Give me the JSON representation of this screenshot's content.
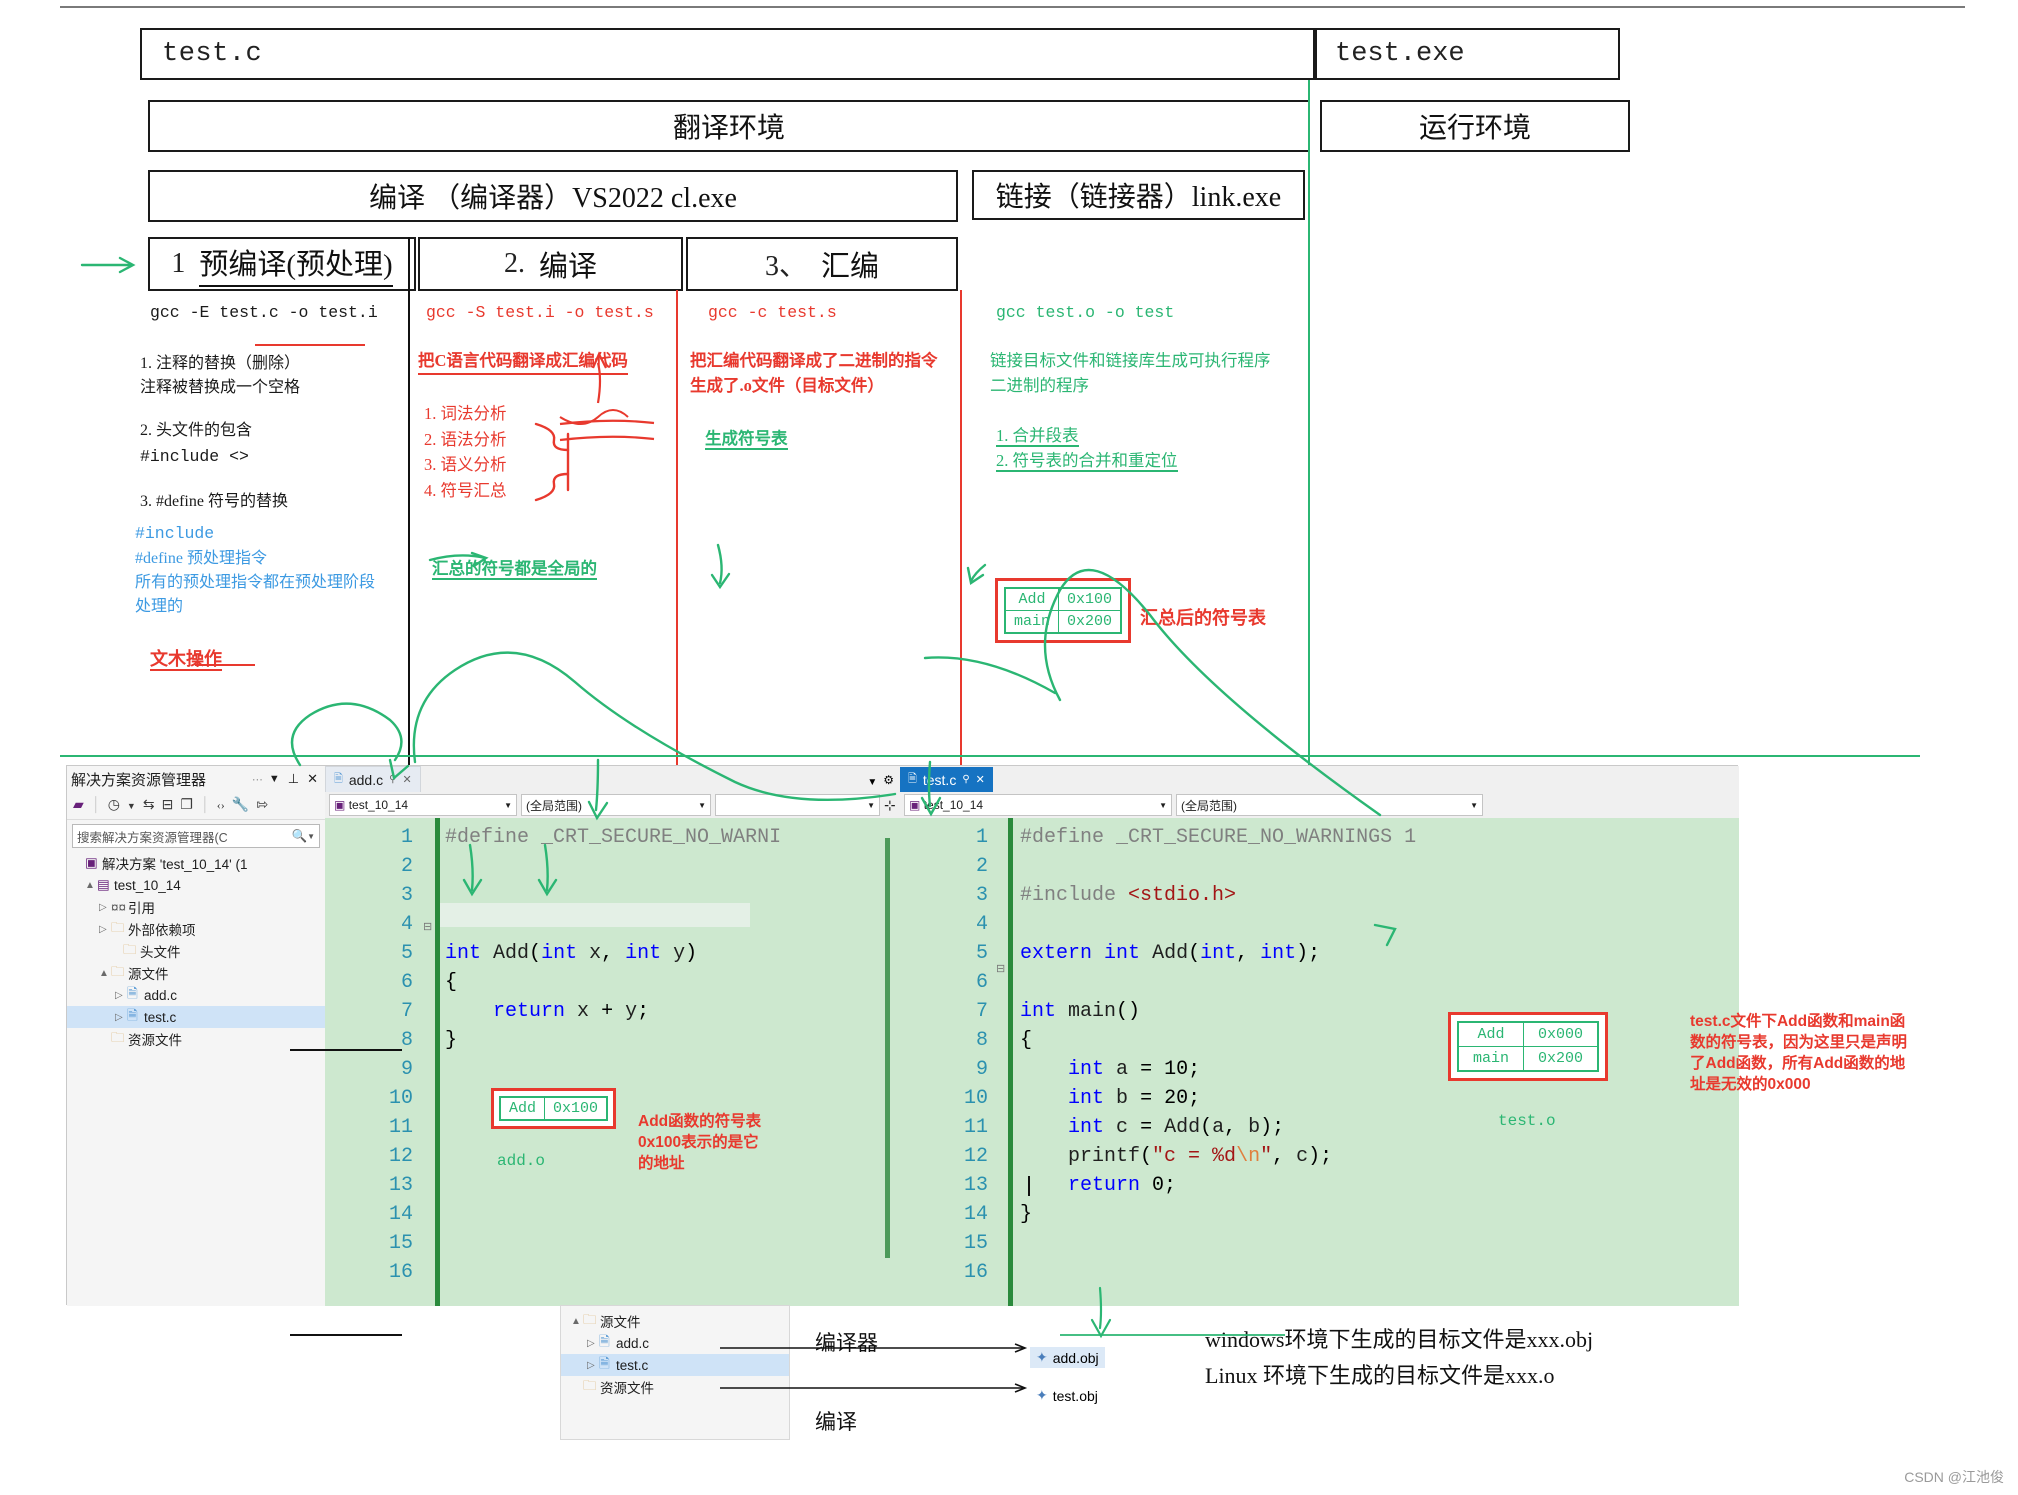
{
  "flow": {
    "source_file": "test.c",
    "exe_file": "test.exe",
    "translate_env": "翻译环境",
    "runtime_env": "运行环境",
    "compile_bar": "编译 （编译器）VS2022 cl.exe",
    "link_bar": "链接（链接器）link.exe"
  },
  "stages": [
    {
      "num": "1",
      "title": "预编译(预处理)"
    },
    {
      "num": "2.",
      "title": "编译"
    },
    {
      "num": "3、",
      "title": "汇编"
    }
  ],
  "col1": {
    "cmd": "gcc -E test.c -o test.i",
    "l1": "1. 注释的替换（删除）",
    "l2": "注释被替换成一个空格",
    "l3": "2. 头文件的包含",
    "l4": "#include <>",
    "l5": "3. #define 符号的替换",
    "b1": "#include",
    "b2": "#define 预处理指令",
    "b3": "所有的预处理指令都在预处理阶段",
    "b4": "处理的",
    "r1": "文木操作"
  },
  "col2": {
    "cmd": "gcc -S test.i -o test.s",
    "desc": "把C语言代码翻译成汇编代码",
    "list": [
      "1.  词法分析",
      "2.  语法分析",
      "3.  语义分析",
      "4.  符号汇总"
    ],
    "green": "汇总的符号都是全局的"
  },
  "col3": {
    "cmd": "gcc -c test.s",
    "d1": "把汇编代码翻译成了二进制的指令",
    "d2": "生成了.o文件（目标文件）",
    "green": "生成符号表"
  },
  "col4": {
    "cmd": "gcc test.o -o test",
    "d1": "链接目标文件和链接库生成可执行程序",
    "d2": "二进制的程序",
    "list": [
      "1.  合并段表",
      "2.  符号表的合并和重定位"
    ]
  },
  "merged_symbols": {
    "label": "汇总后的符号表",
    "rows": [
      [
        "Add",
        "0x100"
      ],
      [
        "main",
        "0x200"
      ]
    ]
  },
  "ide": {
    "solution_explorer": {
      "title": "解决方案资源管理器",
      "title_icons": [
        "more-icon",
        "chevron-down-icon",
        "pin-icon",
        "close-icon"
      ],
      "toolbar_icons": [
        "home-icon",
        "history-icon",
        "sync-icon",
        "collapse-icon",
        "copy-icon",
        "code-icon",
        "properties-icon",
        "show-all-icon"
      ],
      "search_placeholder": "搜索解决方案资源管理器(C",
      "tree": [
        {
          "label": "解决方案 'test_10_14' (1",
          "depth": 0,
          "arrow": "",
          "icon": "solution-icon"
        },
        {
          "label": "test_10_14",
          "depth": 1,
          "arrow": "▲",
          "icon": "project-icon"
        },
        {
          "label": "引用",
          "depth": 2,
          "arrow": "▷",
          "icon": "references-icon"
        },
        {
          "label": "外部依赖项",
          "depth": 2,
          "arrow": "▷",
          "icon": "folder-icon"
        },
        {
          "label": "头文件",
          "depth": 2,
          "arrow": "",
          "icon": "folder-icon"
        },
        {
          "label": "源文件",
          "depth": 2,
          "arrow": "▲",
          "icon": "folder-icon"
        },
        {
          "label": "add.c",
          "depth": 3,
          "arrow": "▷",
          "icon": "c-file-icon"
        },
        {
          "label": "test.c",
          "depth": 3,
          "arrow": "▷",
          "icon": "c-file-icon",
          "selected": true
        },
        {
          "label": "资源文件",
          "depth": 2,
          "arrow": "",
          "icon": "folder-icon"
        }
      ]
    },
    "paneA": {
      "tab": "add.c",
      "scope_left": "test_10_14",
      "scope_right": "(全局范围)",
      "lines": [
        "1",
        "2",
        "3",
        "4",
        "5",
        "6",
        "7",
        "8",
        "9",
        "10",
        "11",
        "12",
        "13",
        "14",
        "15",
        "16"
      ],
      "code": [
        "#define _CRT_SECURE_NO_WARNI",
        "",
        "",
        "",
        "int Add(int x, int y)",
        "{",
        "    return x + y;",
        "}",
        "",
        "",
        "",
        "",
        "",
        "",
        "",
        ""
      ]
    },
    "paneB": {
      "tab": "test.c",
      "scope_left": "test_10_14",
      "scope_right": "(全局范围)",
      "lines": [
        "1",
        "2",
        "3",
        "4",
        "5",
        "6",
        "7",
        "8",
        "9",
        "10",
        "11",
        "12",
        "13",
        "14",
        "15",
        "16"
      ],
      "code": [
        "#define _CRT_SECURE_NO_WARNINGS 1",
        "",
        "#include <stdio.h>",
        "",
        "extern int Add(int, int);",
        "",
        "int main()",
        "{",
        "    int a = 10;",
        "    int b = 20;",
        "    int c = Add(a, b);",
        "    printf(\"c = %d\\n\", c);",
        "    return 0;",
        "}",
        "",
        ""
      ]
    }
  },
  "annotations": {
    "add_symtab": {
      "rows": [
        [
          "Add",
          "0x100"
        ]
      ],
      "file": "add.o",
      "note_l1": "Add函数的符号表",
      "note_l2": "0x100表示的是它",
      "note_l3": "的地址"
    },
    "test_symtab": {
      "rows": [
        [
          "Add",
          "0x000"
        ],
        [
          "main",
          "0x200"
        ]
      ],
      "file": "test.o",
      "note_l1": "test.c文件下Add函数和main函",
      "note_l2": "数的符号表，因为这里只是声明",
      "note_l3": "了Add函数，所有Add函数的地",
      "note_l4": "址是无效的0x000"
    }
  },
  "bottom": {
    "tree": [
      {
        "label": "源文件",
        "depth": 0,
        "arrow": "▲",
        "icon": "folder-icon"
      },
      {
        "label": "add.c",
        "depth": 1,
        "arrow": "▷",
        "icon": "c-file-icon"
      },
      {
        "label": "test.c",
        "depth": 1,
        "arrow": "▷",
        "icon": "c-file-icon",
        "selected": true
      },
      {
        "label": "资源文件",
        "depth": 0,
        "arrow": "",
        "icon": "folder-icon"
      }
    ],
    "compiler_top": "编译器",
    "compiler_bottom": "编译",
    "obj1": "add.obj",
    "obj2": "test.obj",
    "line1": "windows环境下生成的目标文件是xxx.obj",
    "line2": "Linux 环境下生成的目标文件是xxx.o"
  },
  "watermark": "CSDN @江池俊"
}
